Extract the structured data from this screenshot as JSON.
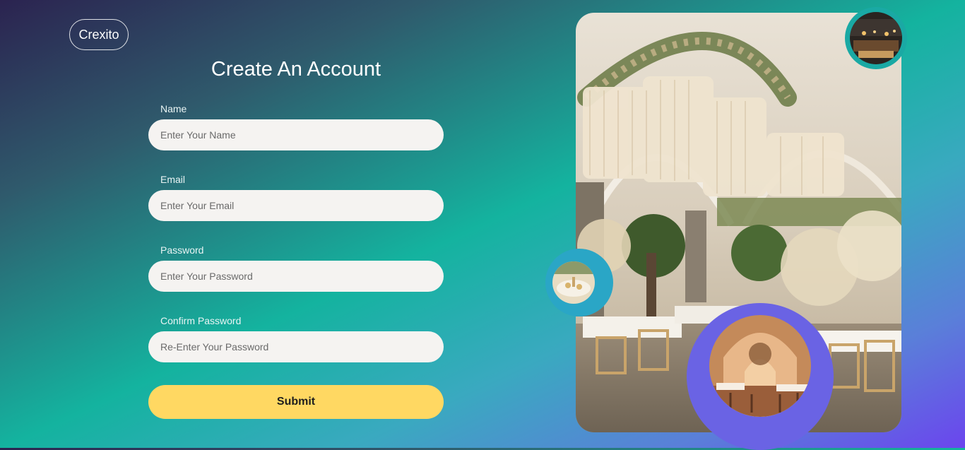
{
  "brand": {
    "logo_text": "Crexito"
  },
  "form": {
    "title": "Create An Account",
    "fields": [
      {
        "label": "Name",
        "placeholder": "Enter Your Name"
      },
      {
        "label": "Email",
        "placeholder": "Enter Your Email"
      },
      {
        "label": "Password",
        "placeholder": "Enter Your Password"
      },
      {
        "label": "Confirm Password",
        "placeholder": "Re-Enter Your Password"
      }
    ],
    "submit_label": "Submit"
  },
  "colors": {
    "accent_button": "#ffd862",
    "ring_teal": "#1aa9a4",
    "ring_blue": "#2aa6c6",
    "ring_purple": "#6a63e4"
  },
  "images": {
    "main": "wedding-venue-photo",
    "thumb_top": "night-venue-photo",
    "thumb_left": "table-setting-photo",
    "thumb_bottom": "dining-hall-photo"
  }
}
